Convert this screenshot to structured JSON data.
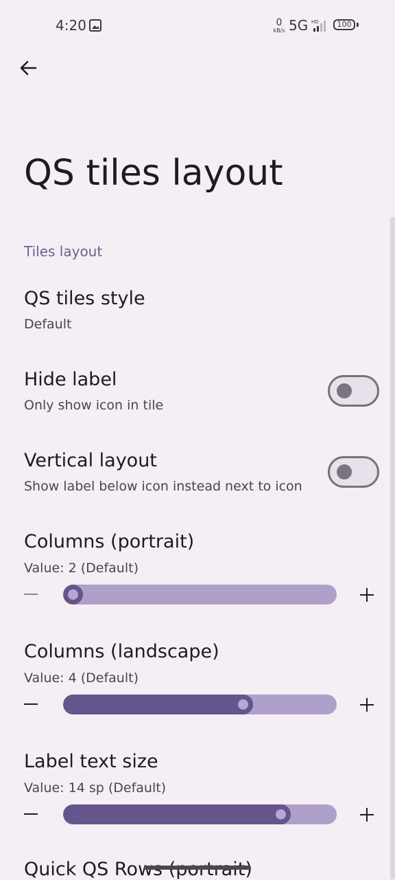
{
  "status_bar": {
    "time": "4:20",
    "net_speed_value": "0",
    "net_speed_unit": "kB/s",
    "network": "5G",
    "battery": "100",
    "icons": [
      "gallery-icon",
      "signal-icon",
      "battery-icon"
    ]
  },
  "header": {
    "back_icon": "arrow-left-icon",
    "title": "QS tiles layout"
  },
  "section": {
    "label": "Tiles layout"
  },
  "items": {
    "tiles_style": {
      "title": "QS tiles style",
      "subtitle": "Default"
    },
    "hide_label": {
      "title": "Hide label",
      "subtitle": "Only show icon in tile",
      "enabled": false
    },
    "vertical_layout": {
      "title": "Vertical layout",
      "subtitle": "Show label below icon instead next to icon",
      "enabled": false
    },
    "columns_portrait": {
      "title": "Columns (portrait)",
      "value_text": "Value: 2 (Default)",
      "level_percent": 0
    },
    "columns_landscape": {
      "title": "Columns (landscape)",
      "value_text": "Value: 4 (Default)",
      "level_percent": 67
    },
    "label_text_size": {
      "title": "Label text size",
      "value_text": "Value: 14 sp (Default)",
      "level_percent": 82
    },
    "quick_qs_rows": {
      "title": "Quick QS Rows (portrait)"
    }
  },
  "colors": {
    "accent": "#66548c",
    "track": "#aea0c8",
    "background": "#f4eff5"
  }
}
